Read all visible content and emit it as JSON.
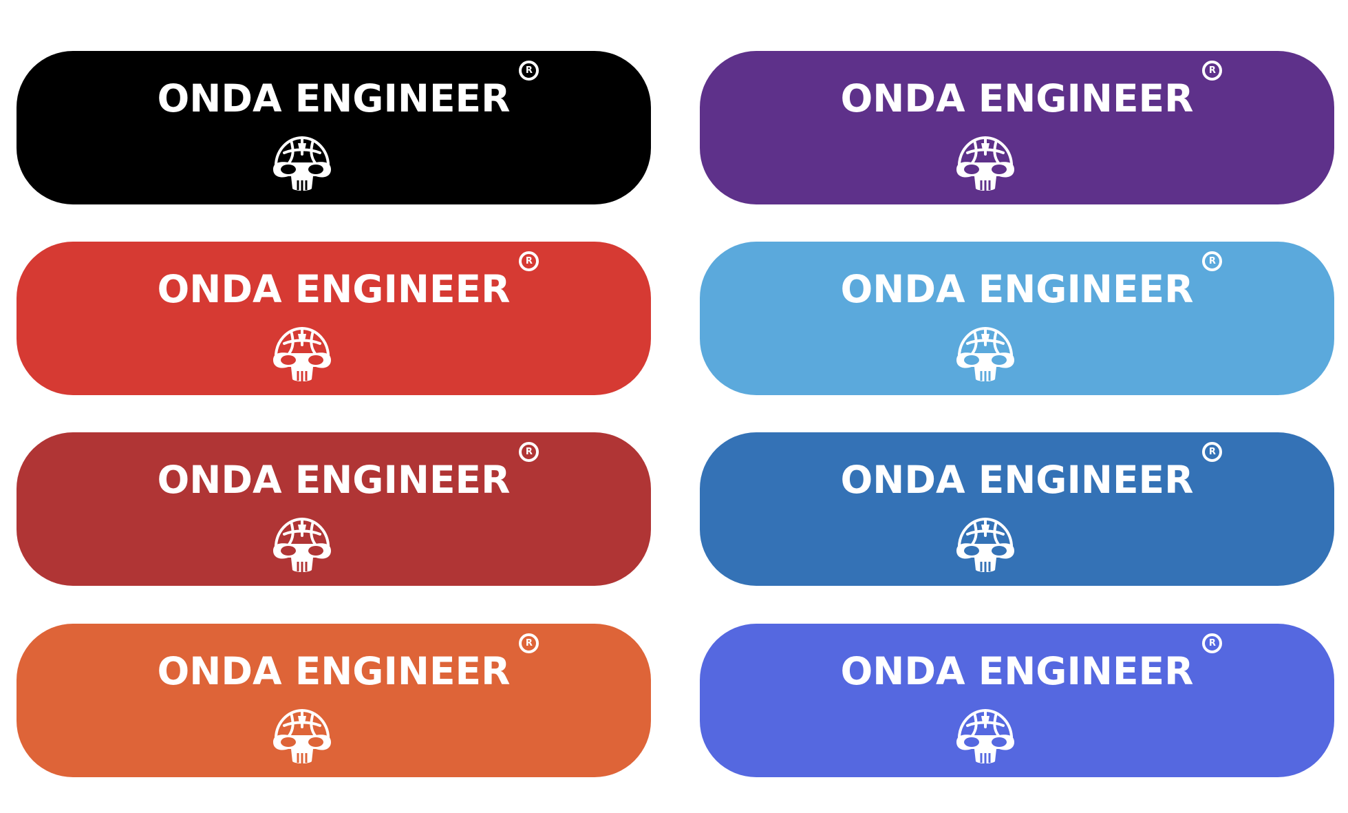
{
  "brand": {
    "name": "ONDA ENGINEER",
    "registered_mark": "R",
    "mascot_icon": "skull-helmet-icon",
    "foreground": "#ffffff"
  },
  "badges": [
    {
      "color": "#000000"
    },
    {
      "color": "#5e318a"
    },
    {
      "color": "#d63a33"
    },
    {
      "color": "#5ba9dc"
    },
    {
      "color": "#b03535"
    },
    {
      "color": "#3472b6"
    },
    {
      "color": "#de6438"
    },
    {
      "color": "#5568e0"
    }
  ]
}
